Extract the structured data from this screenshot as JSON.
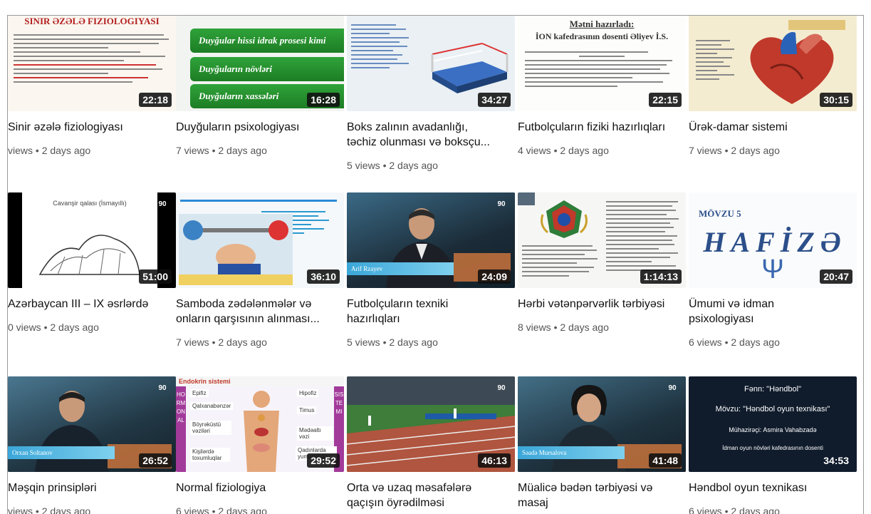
{
  "videos": [
    {
      "title": "Sinir əzələ fiziologiyası",
      "meta": "views • 2 days ago",
      "duration": "22:18",
      "thumb_text": "SINIR ƏZƏLƏ FIZIOLOGIYASI",
      "thumb_icon": "document-thumbnail"
    },
    {
      "title": "Duyğuların psixologiyası",
      "meta": "7 views • 2 days ago",
      "duration": "16:28",
      "thumb_lines": [
        "Duyğular hissi idrak prosesi kimi",
        "Duyğuların növləri",
        "Duyğuların xassələri"
      ]
    },
    {
      "title": "Boks zalının avadanlığı,\ntəchiz olunması və boksçu...",
      "meta": "5 views • 2 days ago",
      "duration": "34:27",
      "thumb_icon": "boxing-ring-thumbnail"
    },
    {
      "title": "Futbolçuların fiziki hazırlıqları",
      "meta": "4 views • 2 days ago",
      "duration": "22:15",
      "thumb_text": "Mətni hazırladı:",
      "thumb_text2": "İON kafedrasının dosenti Əliyev İ.S."
    },
    {
      "title": "Ürək-damar sistemi",
      "meta": "7 views • 2 days ago",
      "duration": "30:15",
      "thumb_icon": "heart-thumbnail"
    },
    {
      "title": "Azərbaycan III – IX əsrlərdə",
      "meta": "0 views • 2 days ago",
      "duration": "51:00",
      "thumb_text": "Cavanşir qalası (İsmayıllı)"
    },
    {
      "title": "Samboda zədələnmələr və\nonların qarşısının alınması...",
      "meta": "7 views • 2 days ago",
      "duration": "36:10",
      "thumb_icon": "weightlifting-thumbnail"
    },
    {
      "title": "Futbolçuların texniki\nhazırlıqları",
      "meta": "5 views • 2 days ago",
      "duration": "24:09",
      "thumb_text": "Arif Rzayev"
    },
    {
      "title": "Hərbi vətənpərvərlik tərbiyəsi",
      "meta": "8 views • 2 days ago",
      "duration": "1:14:13",
      "thumb_icon": "emblem-document-thumbnail"
    },
    {
      "title": "Ümumi və idman\npsixologiyası",
      "meta": "6 views • 2 days ago",
      "duration": "20:47",
      "thumb_text": "MÖVZU 5",
      "thumb_text2": "HAFİZƏ",
      "thumb_text3": "Ψ"
    },
    {
      "title": "Məşqin prinsipləri",
      "meta": "views • 2 days ago",
      "duration": "26:52",
      "thumb_text": "Orxan Soltanov"
    },
    {
      "title": "Normal fiziologiya",
      "meta": "6 views • 2 days ago",
      "duration": "29:52",
      "thumb_text": "Endokrin sistemi",
      "thumb_text2": "HORMONAL",
      "thumb_text3": "SISTEMI",
      "thumb_labels": [
        "Epifiz",
        "Hipofiz",
        "Qalxanabənzər",
        "Timus",
        "Böyrəküstü vəziləri",
        "Mədəaltı vəzi",
        "Kişilərdə toxumluqlar",
        "Qadınlarda yumurtalıqlar"
      ]
    },
    {
      "title": "Orta və uzaq məsafələrə\nqaçışın öyrədilməsi",
      "meta": "",
      "duration": "46:13",
      "thumb_icon": "running-track-thumbnail"
    },
    {
      "title": "Müalicə bədən tərbiyəsi və\nmasaj",
      "meta": "",
      "duration": "41:48",
      "thumb_text": "Səadə Mursalova"
    },
    {
      "title": "Həndbol oyun texnikası",
      "meta": "6 views • 2 days ago",
      "duration": "34:53",
      "thumb_lines": [
        "Fənn: \"Həndbol\"",
        "Mövzu: \"Həndbol oyun texnikası\"",
        "Mühazirəçi: Asmira Vahabzadə",
        "İdman oyun növləri kafedrasının dosenti"
      ]
    }
  ],
  "colors": {
    "duration_bg": "#0f0f0f",
    "title": "#111111",
    "meta": "#555555",
    "green_band": "#2fa33a"
  }
}
